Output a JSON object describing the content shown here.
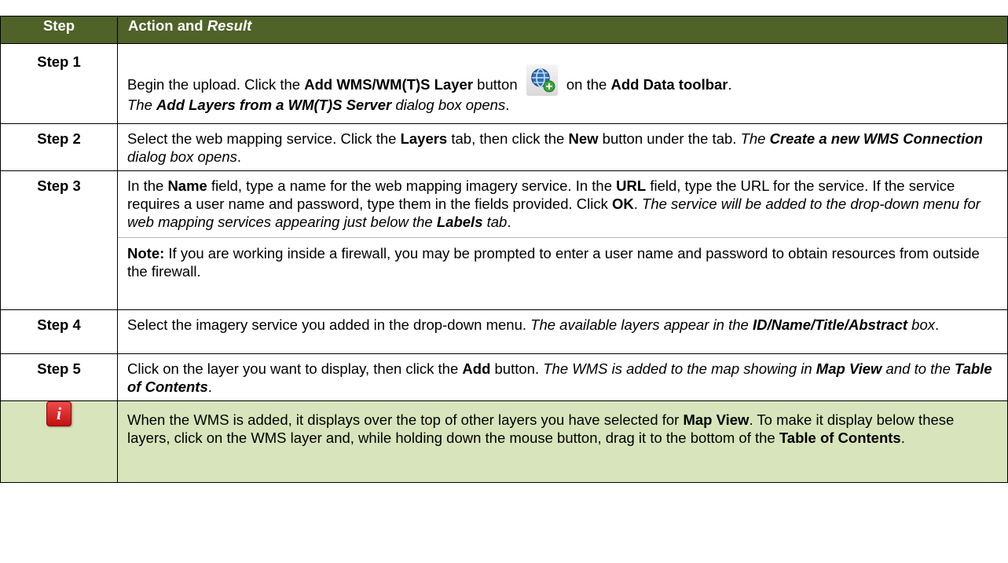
{
  "header": {
    "step": "Step",
    "action": "Action and ",
    "result": "Result"
  },
  "rows": [
    {
      "step": "Step 1",
      "p1_a": "Begin the upload. Click the ",
      "p1_b": "Add WMS/WM(T)S Layer",
      "p1_c": " button ",
      "p1_d": " on the ",
      "p1_e": "Add Data toolbar",
      "p1_f": ".",
      "p2_a": "The ",
      "p2_b": "Add Layers from a WM(T)S Server",
      "p2_c": " dialog box opens",
      "p2_d": "."
    },
    {
      "step": "Step 2",
      "a": "Select the web mapping service. Click the ",
      "b": "Layers",
      "c": " tab, then click the ",
      "d": "New",
      "e": " button under the tab. ",
      "f": "The ",
      "g": "Create a new WMS Connection",
      "h": " dialog box opens",
      "i": "."
    },
    {
      "step": "Step 3",
      "a": "In the ",
      "b": "Name",
      "c": " field, type a name for the web mapping imagery service. In the ",
      "d": "URL",
      "e": " field, type the URL for the service. If the service requires a user name and password, type them in the fields provided. Click ",
      "f": "OK",
      "g": ". ",
      "h": "The service will be added to the drop-down menu for web mapping services appearing just below the ",
      "i": "Labels",
      "j": " tab",
      "k": ".",
      "note_label": "Note:",
      "note_text": " If you are working inside a firewall, you may be prompted to enter a user name and password to obtain resources from outside the firewall."
    },
    {
      "step": "Step 4",
      "a": "Select the imagery service you added in the drop-down menu. ",
      "b": "The available layers appear in the ",
      "c": "ID/Name/Title/Abstract",
      "d": " box",
      "e": "."
    },
    {
      "step": "Step 5",
      "a": "Click on the layer you want to display, then click the ",
      "b": "Add",
      "c": " button. ",
      "d": "The WMS is added to the map showing in ",
      "e": "Map View",
      "f": " and to the ",
      "g": "Table of Contents",
      "h": "."
    }
  ],
  "tip": {
    "icon": "info-icon",
    "icon_letter": "i",
    "a": "When the WMS is added, it displays over the top of other layers you have selected for ",
    "b": "Map View",
    "c": ". To make it display below these layers, click on the WMS layer and, while holding down the mouse button, drag it to the bottom of the ",
    "d": "Table of Contents",
    "e": "."
  },
  "colors": {
    "header_bg": "#4f6228",
    "tip_bg": "#d8e4bc",
    "icon_red": "#c40f0f"
  }
}
